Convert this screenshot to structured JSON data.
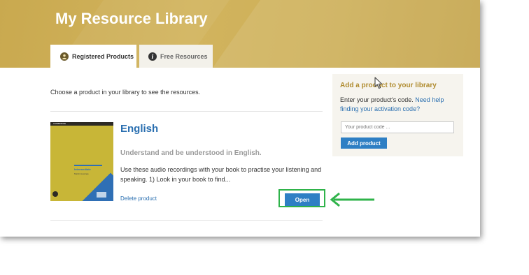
{
  "header": {
    "title": "My Resource Library"
  },
  "tabs": [
    {
      "label": "Registered Products",
      "icon": "user-icon",
      "active": true
    },
    {
      "label": "Free Resources",
      "icon": "info-icon",
      "active": false
    }
  ],
  "main": {
    "intro": "Choose a product in your library to see the resources.",
    "product": {
      "title": "English",
      "subtitle": "Understand and be understood in English.",
      "description": "Use these audio recordings with your book to practise your listening and speaking. 1) Look in your book to find...",
      "delete_label": "Delete product",
      "open_label": "Open",
      "cover": {
        "brand": "CAMBRIDGE",
        "level": "Intermediate",
        "author": "Martin Hewings"
      }
    }
  },
  "sidebar": {
    "title": "Add a product to your library",
    "text": "Enter your product's code.",
    "help_link": "Need help finding your activation code?",
    "input_placeholder": "Your product code ...",
    "button_label": "Add product"
  },
  "colors": {
    "brand_gold": "#c9a94f",
    "link_blue": "#2a6fb0",
    "button_blue": "#2e7fc4",
    "highlight_green": "#2fb34a"
  }
}
